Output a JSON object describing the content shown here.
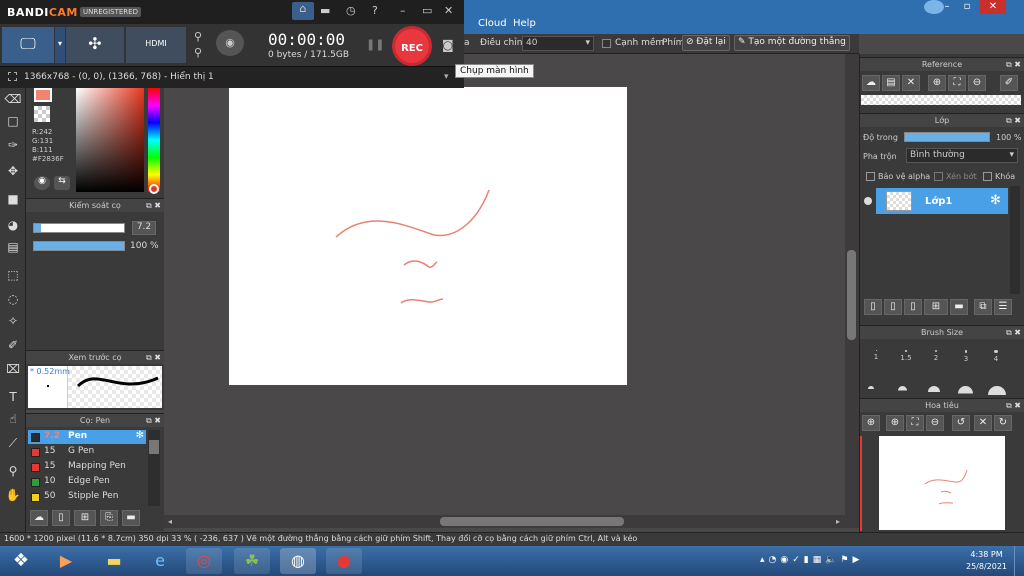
{
  "bandicam": {
    "brand_bandi": "BANDI",
    "brand_cam": "CAM",
    "unregistered": "UNREGISTERED",
    "timer": "00:00:00",
    "bytes": "0 bytes / 171.5GB",
    "rec_label": "REC",
    "hdmi_label": "HDMI",
    "resolution_text": "1366x768 - (0, 0), (1366, 768) - Hiển thị 1",
    "tooltip": "Chụp màn hình"
  },
  "menu": {
    "items": [
      "Cloud",
      "Help"
    ]
  },
  "options_bar": {
    "partial_label": "a",
    "adjust_label": "Điều chỉnh",
    "adjust_value": "40",
    "antialias_label": "Cạnh mềm",
    "key_label": "Phím",
    "reset_label": "Đặt lại",
    "line_label": "Tạo một đường thẳng"
  },
  "color": {
    "rgb_text": "R:242\nG:131\nB:111\n#F2836F",
    "primary": "#F2836F"
  },
  "brush_control": {
    "title": "Kiểm soát cọ",
    "size_value": "7.2",
    "opacity_value": "100 %",
    "size_fraction": 0.08,
    "opacity_fraction": 1.0
  },
  "brush_preview": {
    "title": "Xem trước cọ",
    "size_text": "* 0.52mm"
  },
  "brush_list": {
    "title": "Cọ: Pen",
    "items": [
      {
        "size": "7.2",
        "name": "Pen",
        "color": "#2b2b2b",
        "selected": true
      },
      {
        "size": "15",
        "name": "G Pen",
        "color": "#e53935",
        "selected": false
      },
      {
        "size": "15",
        "name": "Mapping Pen",
        "color": "#e53935",
        "selected": false
      },
      {
        "size": "10",
        "name": "Edge Pen",
        "color": "#2e9e3a",
        "selected": false
      },
      {
        "size": "50",
        "name": "Stipple Pen",
        "color": "#f0d020",
        "selected": false
      }
    ]
  },
  "reference": {
    "title": "Reference"
  },
  "layers": {
    "title": "Lớp",
    "opacity_label": "Độ trong",
    "opacity_value": "100 %",
    "blend_label": "Pha trộn",
    "blend_value": "Bình thường",
    "protect_alpha": "Bảo vệ alpha",
    "clipping": "Xén bớt",
    "lock": "Khóa",
    "layer_name": "Lớp1"
  },
  "brush_size": {
    "title": "Brush Size",
    "sizes": [
      "1",
      "1.5",
      "2",
      "3",
      "4"
    ]
  },
  "navigator": {
    "title": "Hoa tiêu"
  },
  "status": {
    "text": "1600 * 1200 pixel   (11.6 * 8.7cm)   350 dpi   33 %   ( -236, 637 )   Vẽ một đường thẳng bằng cách giữ phím Shift, Thay đổi cỡ cọ bằng cách giữ phím Ctrl, Alt và kéo"
  },
  "taskbar": {
    "time": "4:38 PM",
    "date": "25/8/2021"
  }
}
